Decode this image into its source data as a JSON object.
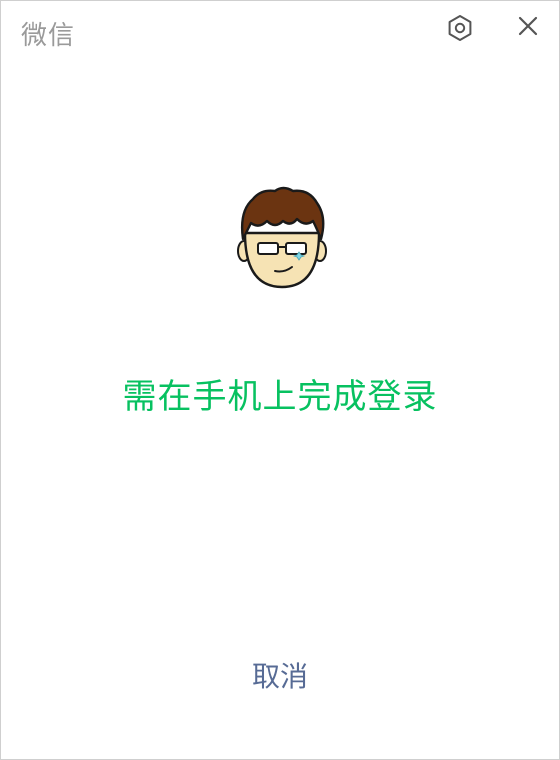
{
  "window": {
    "title": "微信"
  },
  "toolbar": {
    "settings_icon": "settings-hexagon-icon",
    "close_icon": "close-icon"
  },
  "main": {
    "avatar": "cartoon-avatar-glasses",
    "status_message": "需在手机上完成登录",
    "cancel_label": "取消"
  },
  "colors": {
    "accent_green": "#07c160",
    "link_blue": "#576b95",
    "title_gray": "#9a9a9a",
    "icon_gray": "#555555"
  }
}
